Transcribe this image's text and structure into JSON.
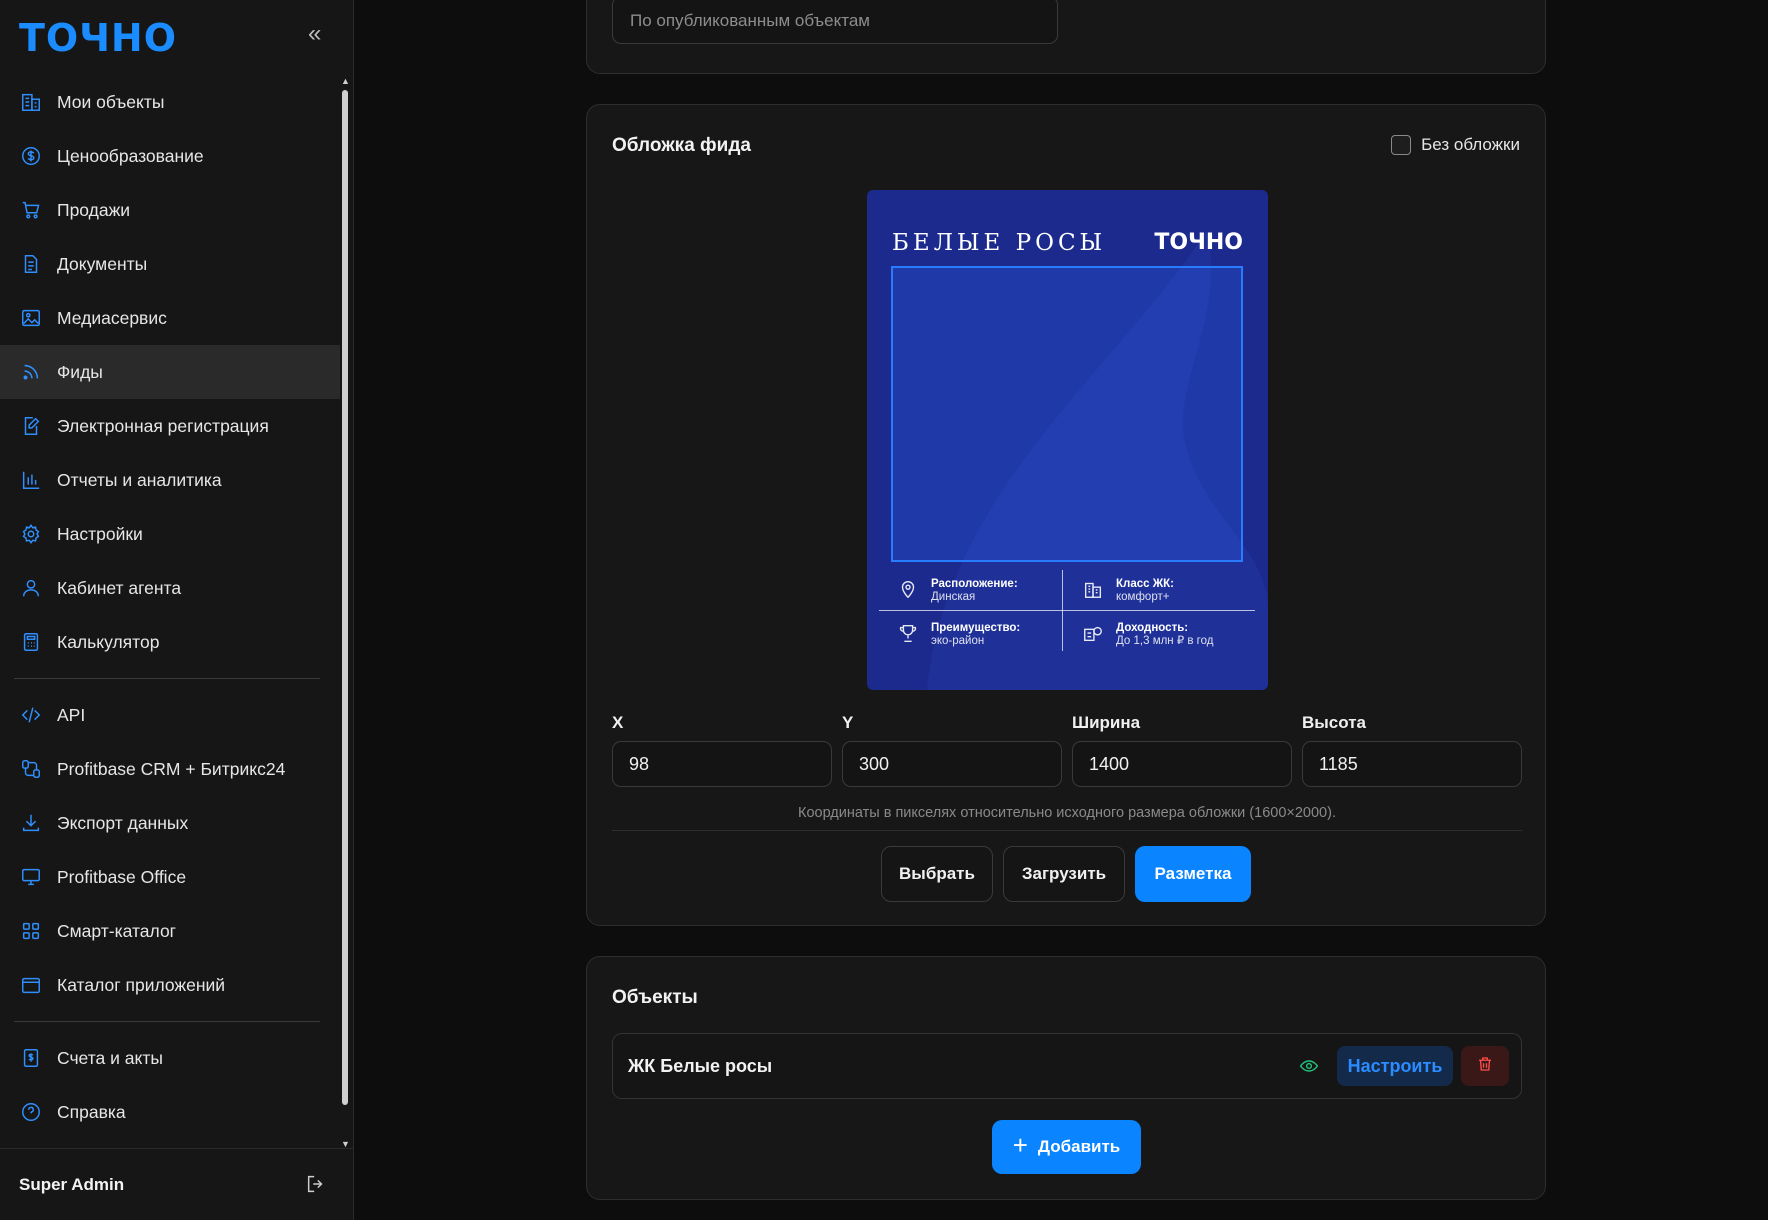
{
  "sidebar": {
    "logo": "ТОЧНО",
    "items": [
      {
        "label": "Мои объекты",
        "icon": "building-icon"
      },
      {
        "label": "Ценообразование",
        "icon": "dollar-circle-icon"
      },
      {
        "label": "Продажи",
        "icon": "cart-icon"
      },
      {
        "label": "Документы",
        "icon": "document-icon"
      },
      {
        "label": "Медиасервис",
        "icon": "image-icon"
      },
      {
        "label": "Фиды",
        "icon": "rss-icon",
        "active": true
      },
      {
        "label": "Электронная регистрация",
        "icon": "edit-document-icon"
      },
      {
        "label": "Отчеты и аналитика",
        "icon": "bar-chart-icon"
      },
      {
        "label": "Настройки",
        "icon": "gear-icon"
      },
      {
        "label": "Кабинет агента",
        "icon": "user-icon"
      },
      {
        "label": "Калькулятор",
        "icon": "calculator-icon"
      }
    ],
    "items2": [
      {
        "label": "API",
        "icon": "code-icon"
      },
      {
        "label": "Profitbase CRM + Битрикс24",
        "icon": "integration-icon"
      },
      {
        "label": "Экспорт данных",
        "icon": "download-icon"
      },
      {
        "label": "Profitbase Office",
        "icon": "monitor-icon"
      },
      {
        "label": "Смарт-каталог",
        "icon": "grid-icon"
      },
      {
        "label": "Каталог приложений",
        "icon": "app-window-icon"
      }
    ],
    "items3": [
      {
        "label": "Счета и акты",
        "icon": "invoice-icon"
      },
      {
        "label": "Справка",
        "icon": "help-icon"
      }
    ],
    "user_name": "Super Admin"
  },
  "top_select": {
    "placeholder": "По опубликованным объектам"
  },
  "cover": {
    "title": "Обложка фида",
    "no_cover_label": "Без обложки",
    "no_cover_checked": false,
    "preview": {
      "name": "БЕЛЫЕ РОСЫ",
      "logo": "ТОЧНО",
      "location_label": "Расположение:",
      "location_value": "Динская",
      "class_label": "Класс ЖК:",
      "class_value": "комфорт+",
      "advantage_label": "Преимущество:",
      "advantage_value": "эко-район",
      "yield_label": "Доходность:",
      "yield_value": "До 1,3 млн ₽ в год"
    },
    "fields": {
      "x_label": "X",
      "x_value": "98",
      "y_label": "Y",
      "y_value": "300",
      "width_label": "Ширина",
      "width_value": "1400",
      "height_label": "Высота",
      "height_value": "1185"
    },
    "hint": "Координаты в пикселях относительно исходного размера обложки (1600×2000).",
    "buttons": {
      "choose": "Выбрать",
      "upload": "Загрузить",
      "layout": "Разметка"
    }
  },
  "objects": {
    "title": "Объекты",
    "items": [
      {
        "name": "ЖК Белые росы",
        "configure_label": "Настроить"
      }
    ],
    "add_label": "Добавить"
  },
  "colors": {
    "accent": "#0a84ff",
    "cover_bg": "#1b2a8c",
    "visible": "#22c07a",
    "danger": "#ff4d4d"
  }
}
